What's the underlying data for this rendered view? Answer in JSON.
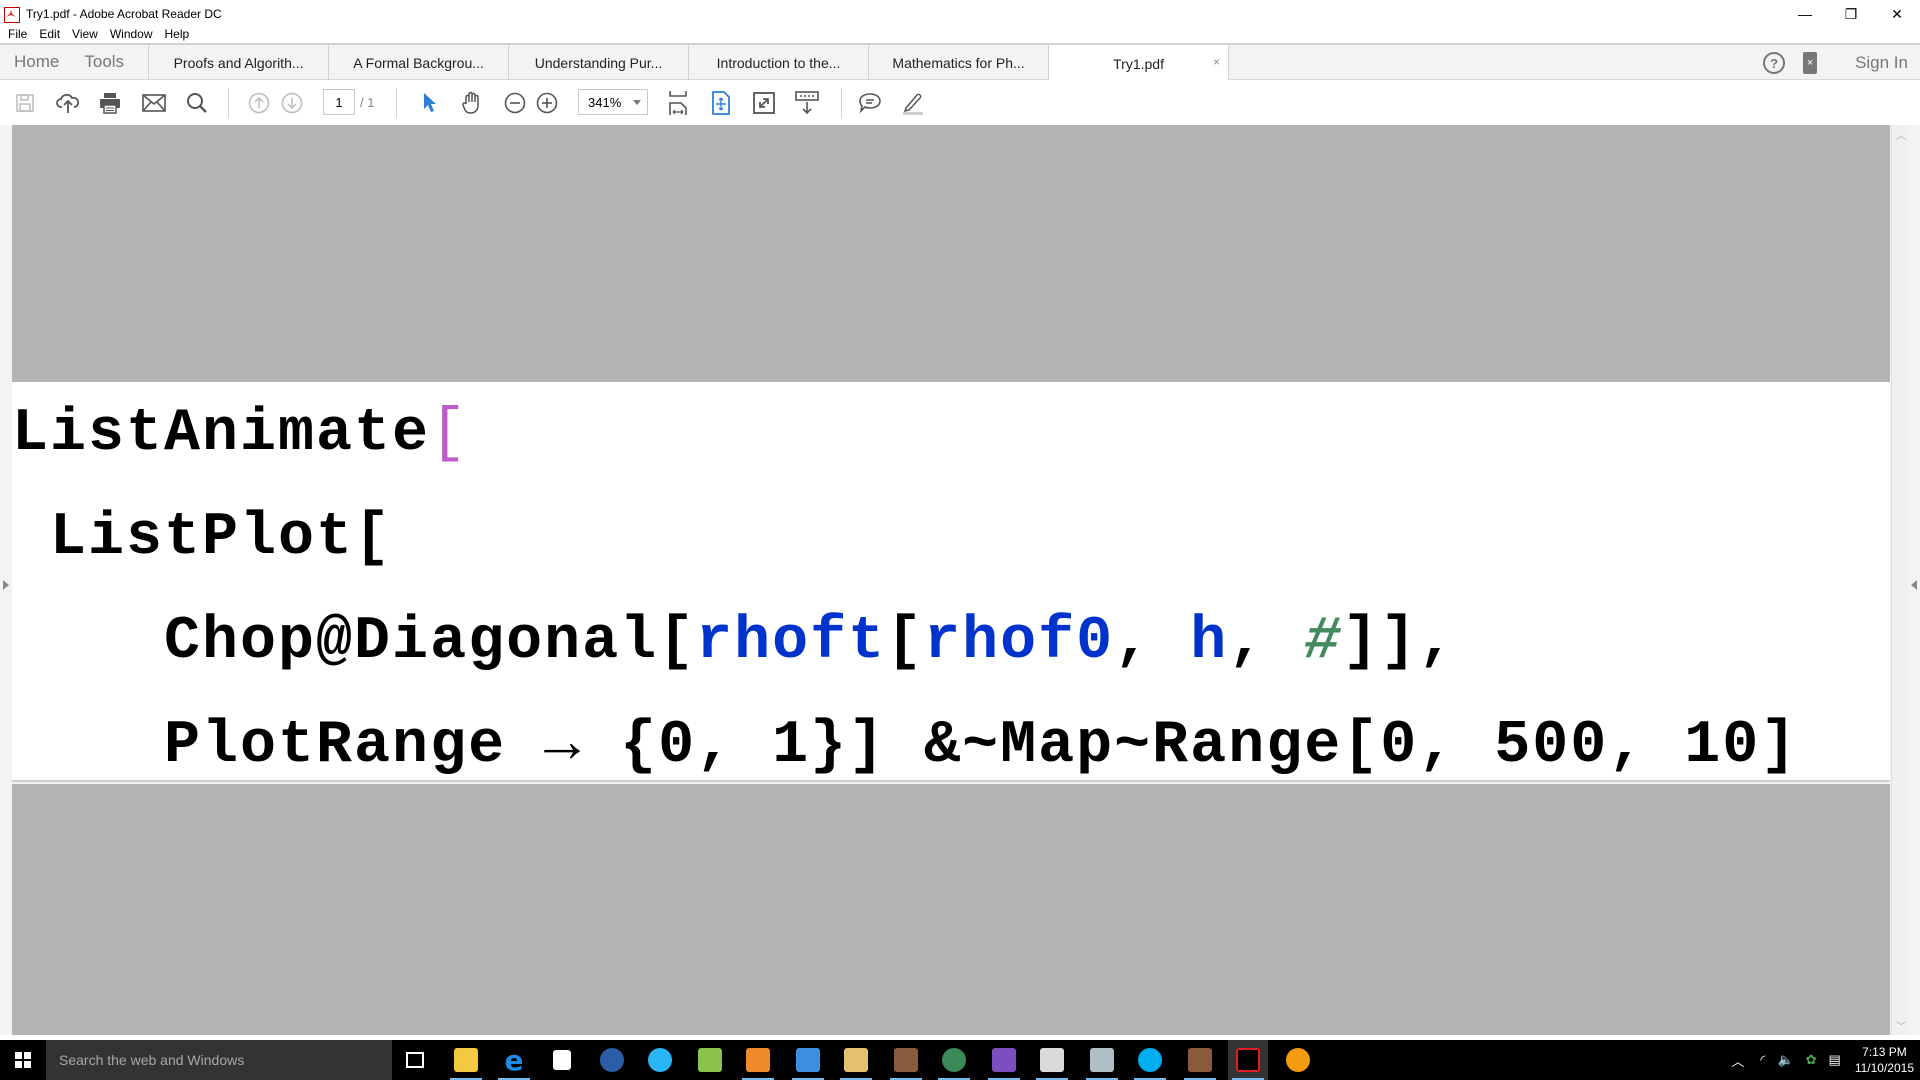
{
  "window": {
    "title": "Try1.pdf - Adobe Acrobat Reader DC",
    "controls": {
      "minimize": "—",
      "restore": "❐",
      "close": "✕"
    }
  },
  "menu": [
    "File",
    "Edit",
    "View",
    "Window",
    "Help"
  ],
  "nav": {
    "home": "Home",
    "tools": "Tools"
  },
  "tabs": [
    {
      "label": "Proofs and Algorith...",
      "active": false
    },
    {
      "label": "A Formal Backgrou...",
      "active": false
    },
    {
      "label": "Understanding Pur...",
      "active": false
    },
    {
      "label": "Introduction to the...",
      "active": false
    },
    {
      "label": "Mathematics for Ph...",
      "active": false
    },
    {
      "label": "Try1.pdf",
      "active": true,
      "close": "×"
    }
  ],
  "header_right": {
    "help": "?",
    "mobile": "×",
    "sign_in": "Sign In"
  },
  "toolbar": {
    "icons": [
      "save-icon",
      "upload-cloud-icon",
      "print-icon",
      "email-icon",
      "search-icon",
      "prev-page-icon",
      "next-page-icon",
      "select-cursor-icon",
      "hand-tool-icon",
      "zoom-out-icon",
      "zoom-in-icon",
      "fit-width-icon",
      "fit-page-icon",
      "full-screen-icon",
      "scroll-mode-icon",
      "comment-icon",
      "highlight-icon"
    ],
    "page_current": "1",
    "page_total": "/ 1",
    "zoom": "341%",
    "accent": "#2d7fd8"
  },
  "document": {
    "lines": [
      [
        {
          "t": "ListAnimate",
          "c": "black"
        },
        {
          "t": "[",
          "c": "purple"
        }
      ],
      [
        {
          "t": " ListPlot[",
          "c": "black"
        }
      ],
      [
        {
          "t": "    Chop@Diagonal[",
          "c": "black"
        },
        {
          "t": "rhoft",
          "c": "blue"
        },
        {
          "t": "[",
          "c": "black"
        },
        {
          "t": "rhof0",
          "c": "blue"
        },
        {
          "t": ", ",
          "c": "black"
        },
        {
          "t": "h",
          "c": "blue"
        },
        {
          "t": ", ",
          "c": "black"
        },
        {
          "t": "#",
          "c": "green"
        },
        {
          "t": "]],",
          "c": "black"
        }
      ],
      [
        {
          "t": "    PlotRange → {0, 1}] &~Map~Range[0, 500, 10]",
          "c": "black"
        }
      ]
    ],
    "colors": {
      "black": "#000000",
      "purple": "#c05ac8",
      "blue": "#0033cc",
      "green": "#438a5e"
    }
  },
  "taskbar": {
    "search_placeholder": "Search the web and Windows",
    "apps": [
      "file-explorer",
      "edge",
      "store",
      "hp",
      "app-blue-orb",
      "app-green",
      "media-player",
      "control-panel",
      "mail-folder",
      "game",
      "greenfoot",
      "notepad-plus",
      "paint-tool",
      "monitor",
      "skype",
      "game-2",
      "acrobat-reader",
      "app-sun"
    ],
    "time": "7:13 PM",
    "date": "11/10/2015"
  }
}
